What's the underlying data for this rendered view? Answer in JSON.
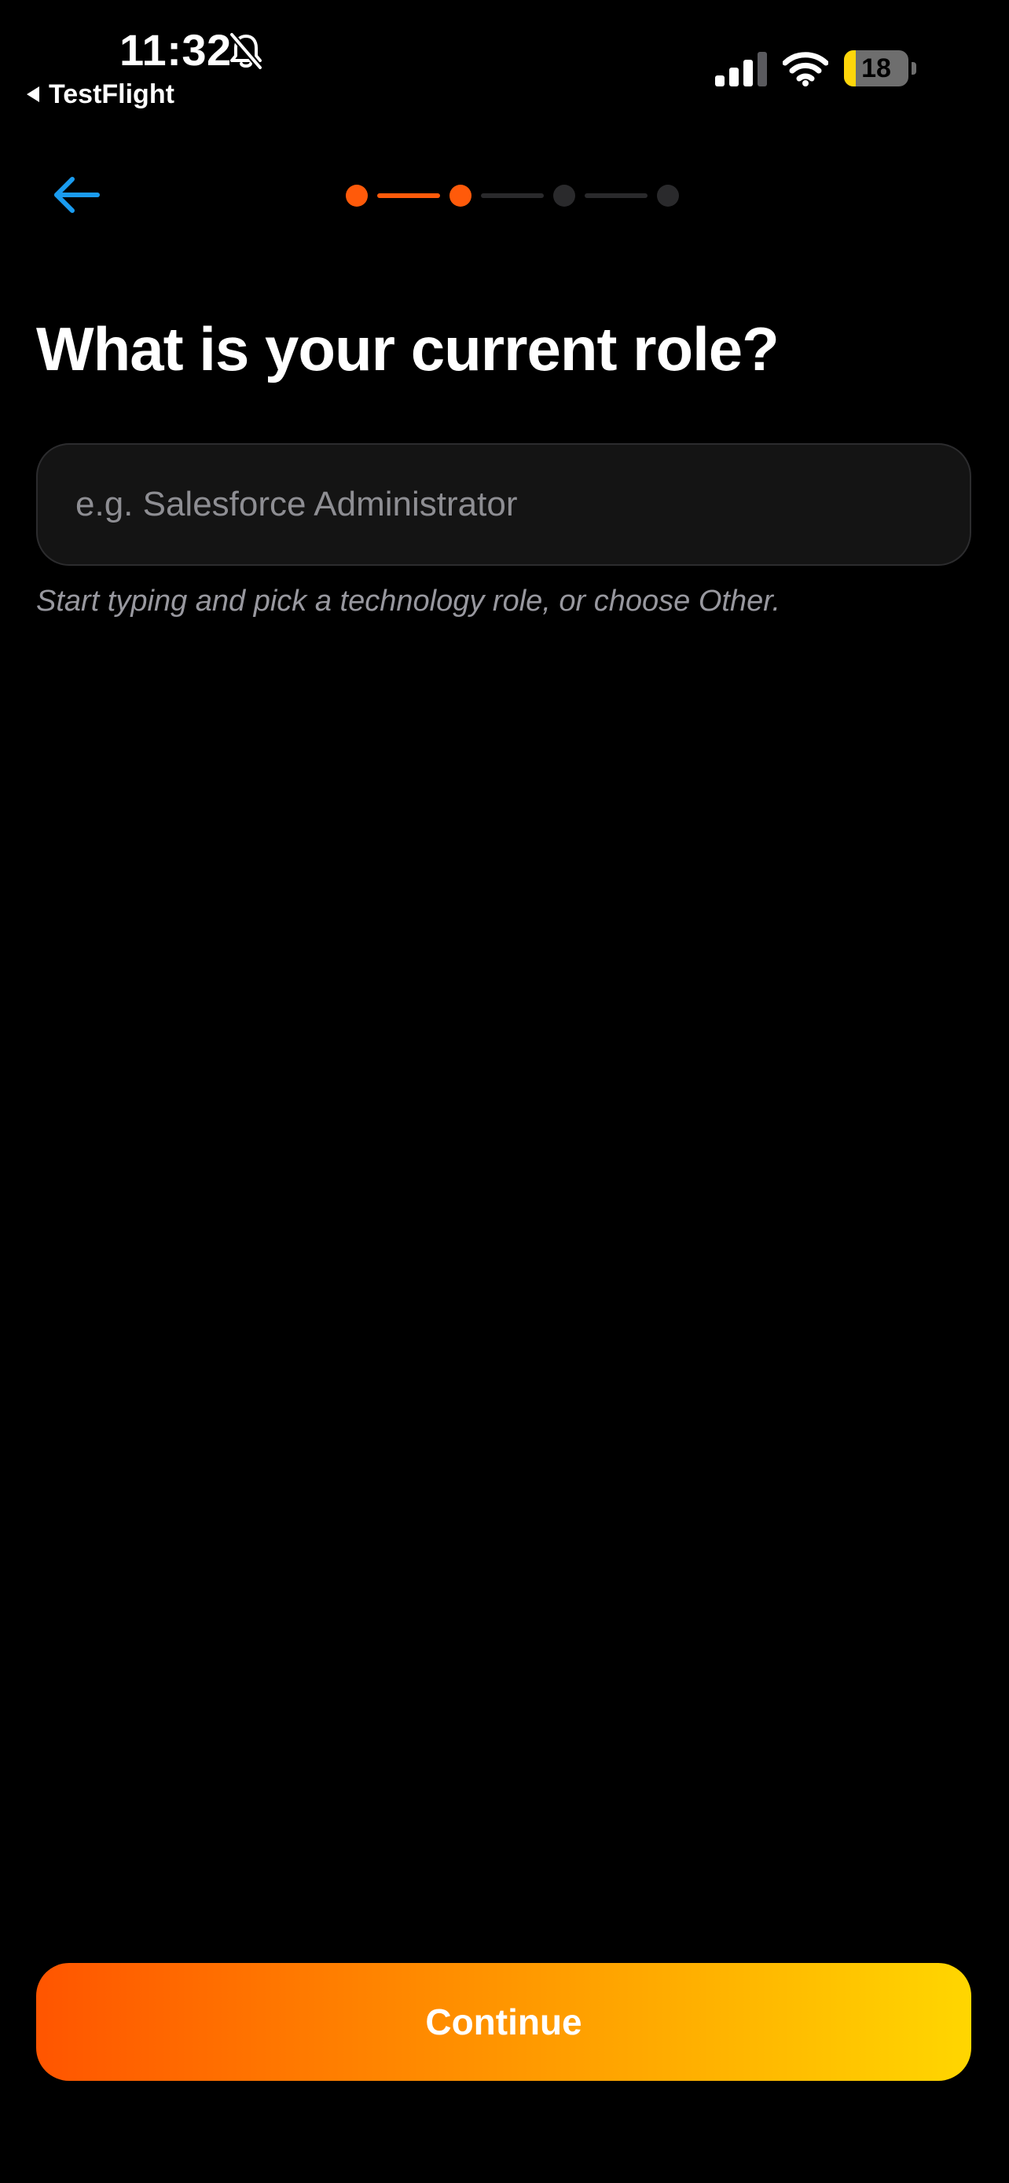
{
  "status_bar": {
    "time": "11:32",
    "back_app_label": "TestFlight",
    "battery_percent": "18",
    "battery_level": 0.18,
    "signal_bars_active": 3,
    "icons": [
      "bell-slash-icon",
      "cellular-signal-icon",
      "wifi-icon",
      "battery-icon"
    ]
  },
  "nav": {
    "back_icon": "arrow-left-icon"
  },
  "progress": {
    "total_steps": 4,
    "completed_steps": 2
  },
  "page": {
    "title": "What is your current role?"
  },
  "role_field": {
    "value": "",
    "placeholder": "e.g. Salesforce Administrator",
    "hint": "Start typing and pick a technology role, or choose Other."
  },
  "actions": {
    "continue_label": "Continue"
  },
  "colors": {
    "background": "#000000",
    "accent_blue": "#1a9cf0",
    "progress_active": "#ff5a0a",
    "progress_inactive": "#2a2a2c",
    "button_gradient_start": "#ff5500",
    "button_gradient_end": "#ffd600",
    "field_background": "#141414",
    "hint_text": "#98989f"
  }
}
